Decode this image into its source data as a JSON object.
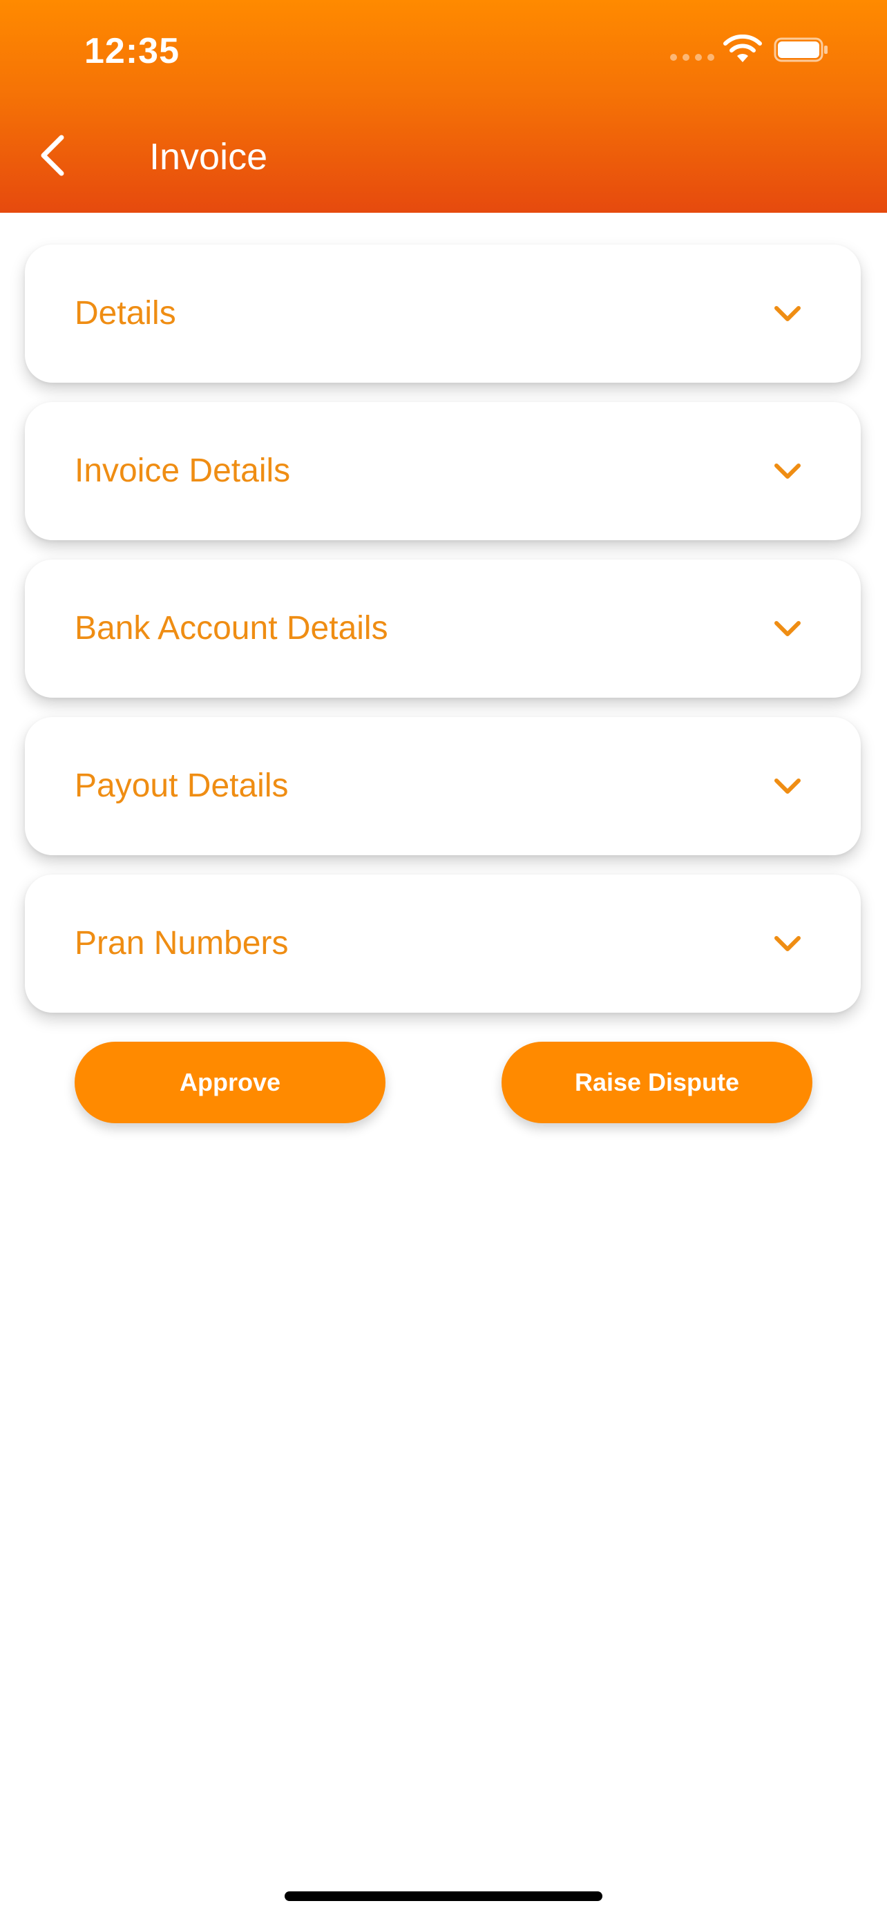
{
  "status_bar": {
    "time": "12:35"
  },
  "nav": {
    "title": "Invoice",
    "back_icon": "chevron-left-icon"
  },
  "sections": [
    {
      "label": "Details"
    },
    {
      "label": "Invoice Details"
    },
    {
      "label": "Bank Account Details"
    },
    {
      "label": "Payout Details"
    },
    {
      "label": "Pran Numbers"
    }
  ],
  "actions": {
    "approve_label": "Approve",
    "dispute_label": "Raise Dispute"
  },
  "colors": {
    "accent": "#ff8a00",
    "section_title": "#ef8d13",
    "header_bottom": "#e64a0e"
  }
}
